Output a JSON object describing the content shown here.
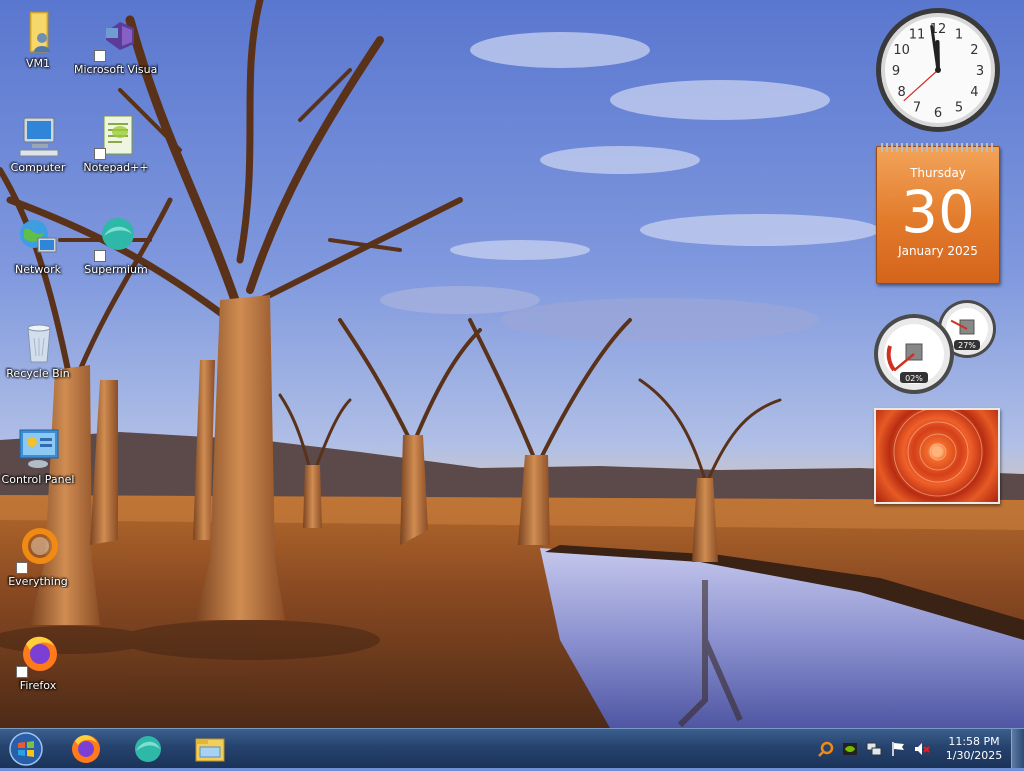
{
  "desktop": {
    "icons": [
      {
        "label": "VM1",
        "icon": "folder-user-icon"
      },
      {
        "label": "Microsoft Visual Stud...",
        "icon": "visual-studio-icon"
      },
      {
        "label": "Computer",
        "icon": "computer-icon"
      },
      {
        "label": "Notepad++",
        "icon": "notepad-plus-plus-icon"
      },
      {
        "label": "Network",
        "icon": "network-icon"
      },
      {
        "label": "Supermium",
        "icon": "supermium-browser-icon"
      },
      {
        "label": "Recycle Bin",
        "icon": "recycle-bin-icon"
      },
      {
        "label": "Control Panel",
        "icon": "control-panel-icon"
      },
      {
        "label": "Everything",
        "icon": "everything-search-icon"
      },
      {
        "label": "Firefox",
        "icon": "firefox-icon"
      }
    ]
  },
  "gadgets": {
    "clock": {
      "hour": 11,
      "minute": 58,
      "second": 38
    },
    "calendar": {
      "day_name": "Thursday",
      "date": "30",
      "month_year": "January 2025"
    },
    "cpu_meter": {
      "cpu_percent": "02%",
      "memory_percent": "27%",
      "cpu_value": 2,
      "memory_value": 27
    },
    "slideshow": {
      "subject": "red-flower-photo"
    }
  },
  "taskbar": {
    "start_icon": "windows-start-orb-icon",
    "pinned": [
      {
        "name": "Firefox",
        "icon": "firefox-icon"
      },
      {
        "name": "Supermium",
        "icon": "supermium-browser-icon"
      },
      {
        "name": "Windows Explorer",
        "icon": "file-explorer-icon"
      }
    ],
    "tray": {
      "icons": [
        "everything-search-icon",
        "nvidia-icon",
        "network-status-icon",
        "action-center-flag-icon",
        "volume-muted-icon"
      ],
      "time": "11:58 PM",
      "date": "1/30/2025"
    }
  },
  "colors": {
    "taskbar": "#26436e",
    "calendar_orange": "#e27a2b",
    "sky_top": "#6f8fd6"
  }
}
